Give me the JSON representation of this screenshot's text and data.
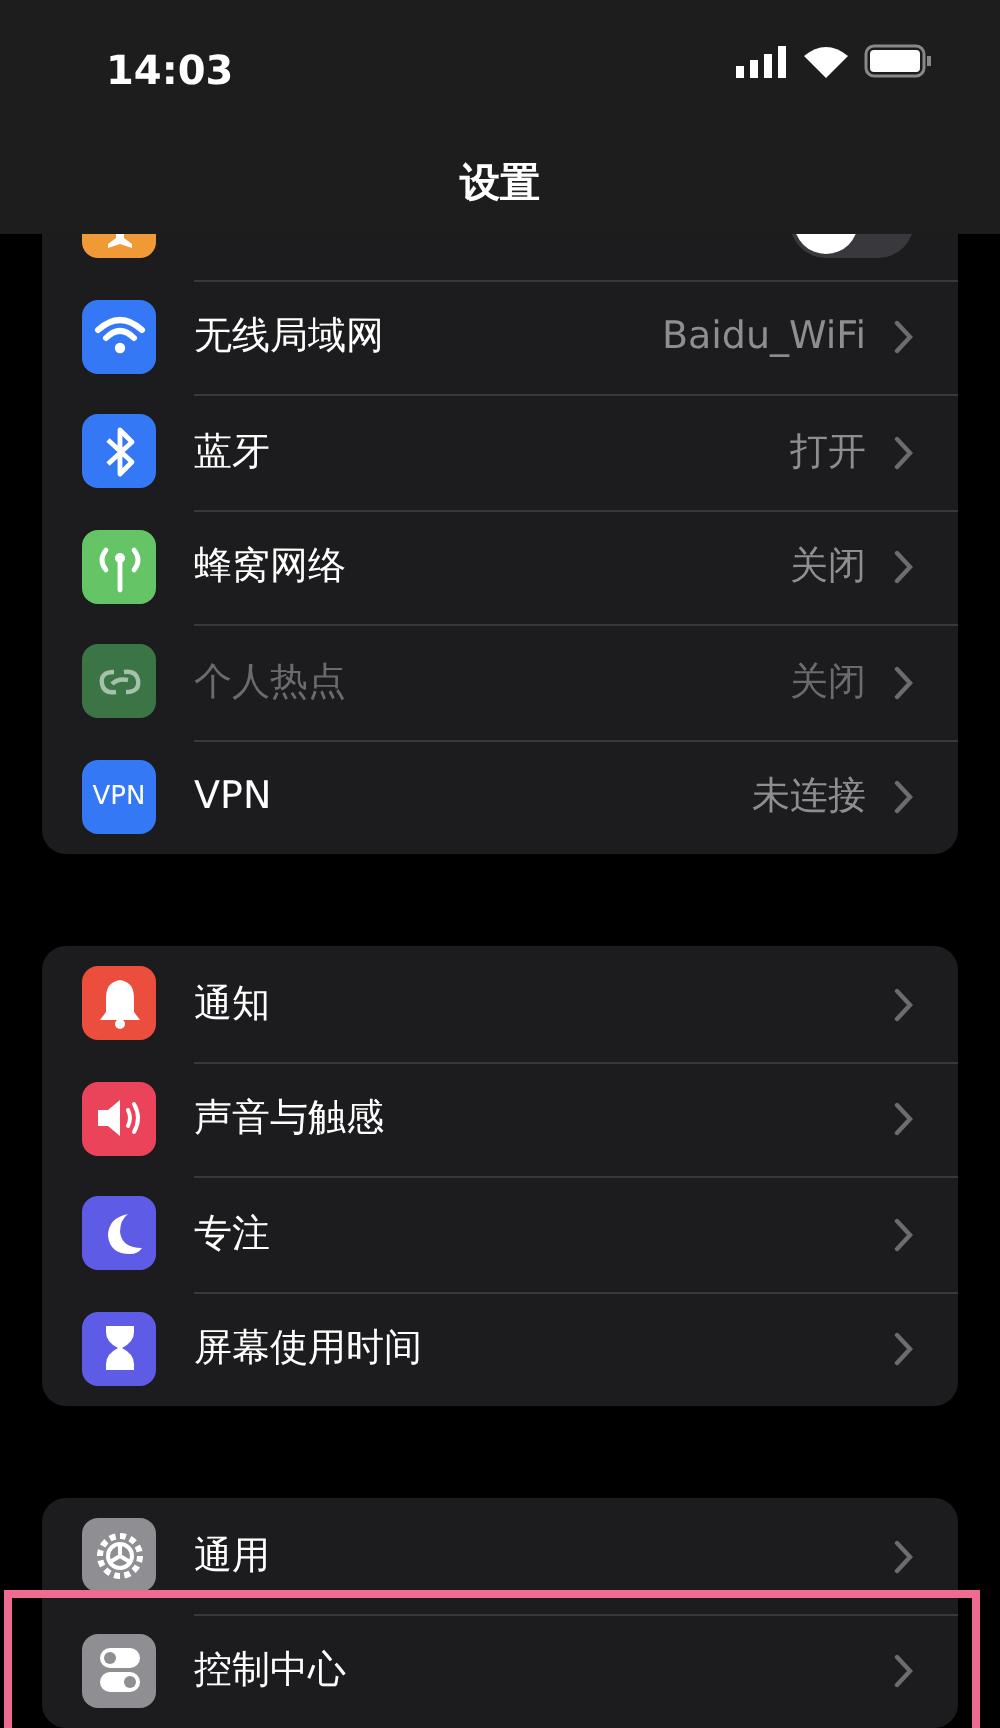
{
  "status_bar": {
    "time": "14:03"
  },
  "nav_bar": {
    "title": "设置"
  },
  "groups": [
    {
      "rows": [
        {
          "kind": "toggle",
          "color": "#f09a37",
          "on": false
        },
        {
          "kind": "link",
          "label": "无线局域网",
          "value": "Baidu_WiFi",
          "color": "#3478f6",
          "disabled": false
        },
        {
          "kind": "link",
          "label": "蓝牙",
          "value": "打开",
          "color": "#3478f6",
          "disabled": false
        },
        {
          "kind": "link",
          "label": "蜂窝网络",
          "value": "关闭",
          "color": "#65c466",
          "disabled": false
        },
        {
          "kind": "link",
          "label": "个人热点",
          "value": "关闭",
          "color": "#3b7445",
          "disabled": true
        },
        {
          "kind": "link",
          "label": "VPN",
          "value": "未连接",
          "color": "#3478f6",
          "badge_text": "VPN",
          "disabled": false
        }
      ]
    },
    {
      "rows": [
        {
          "kind": "link",
          "label": "通知",
          "color": "#eb4e3d",
          "disabled": false
        },
        {
          "kind": "link",
          "label": "声音与触感",
          "color": "#eb445a",
          "disabled": false
        },
        {
          "kind": "link",
          "label": "专注",
          "color": "#5e5ce6",
          "disabled": false
        },
        {
          "kind": "link",
          "label": "屏幕使用时间",
          "color": "#5e5ce6",
          "disabled": false
        }
      ]
    },
    {
      "rows": [
        {
          "kind": "link",
          "label": "通用",
          "color": "#8e8e93",
          "disabled": false,
          "highlighted": false
        },
        {
          "kind": "link",
          "label": "控制中心",
          "color": "#8e8e93",
          "disabled": false,
          "highlighted": true
        }
      ]
    }
  ]
}
